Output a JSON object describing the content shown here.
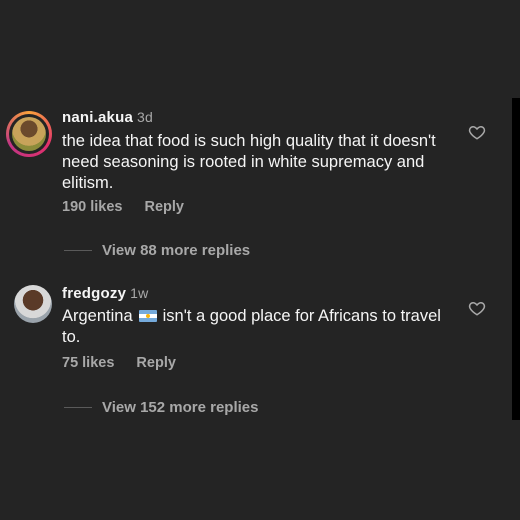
{
  "comments": [
    {
      "username": "nani.akua",
      "time": "3d",
      "text": "the idea that food is such high quality that it doesn't need seasoning is rooted in white supremacy and elitism.",
      "likes": "190 likes",
      "reply": "Reply",
      "view_replies": "View 88 more replies",
      "avatar_icon": "profile-photo-with-story-ring"
    },
    {
      "username": "fredgozy",
      "time": "1w",
      "text_before_flag": "Argentina",
      "flag_icon": "argentina-flag",
      "text_after_flag": "isn't a good place for Africans to travel to.",
      "likes": "75 likes",
      "reply": "Reply",
      "view_replies": "View 152 more replies",
      "avatar_icon": "profile-photo"
    }
  ],
  "colors": {
    "background": "#242424",
    "primary_text": "#f5f5f5",
    "secondary_text": "#a8a8a8"
  }
}
